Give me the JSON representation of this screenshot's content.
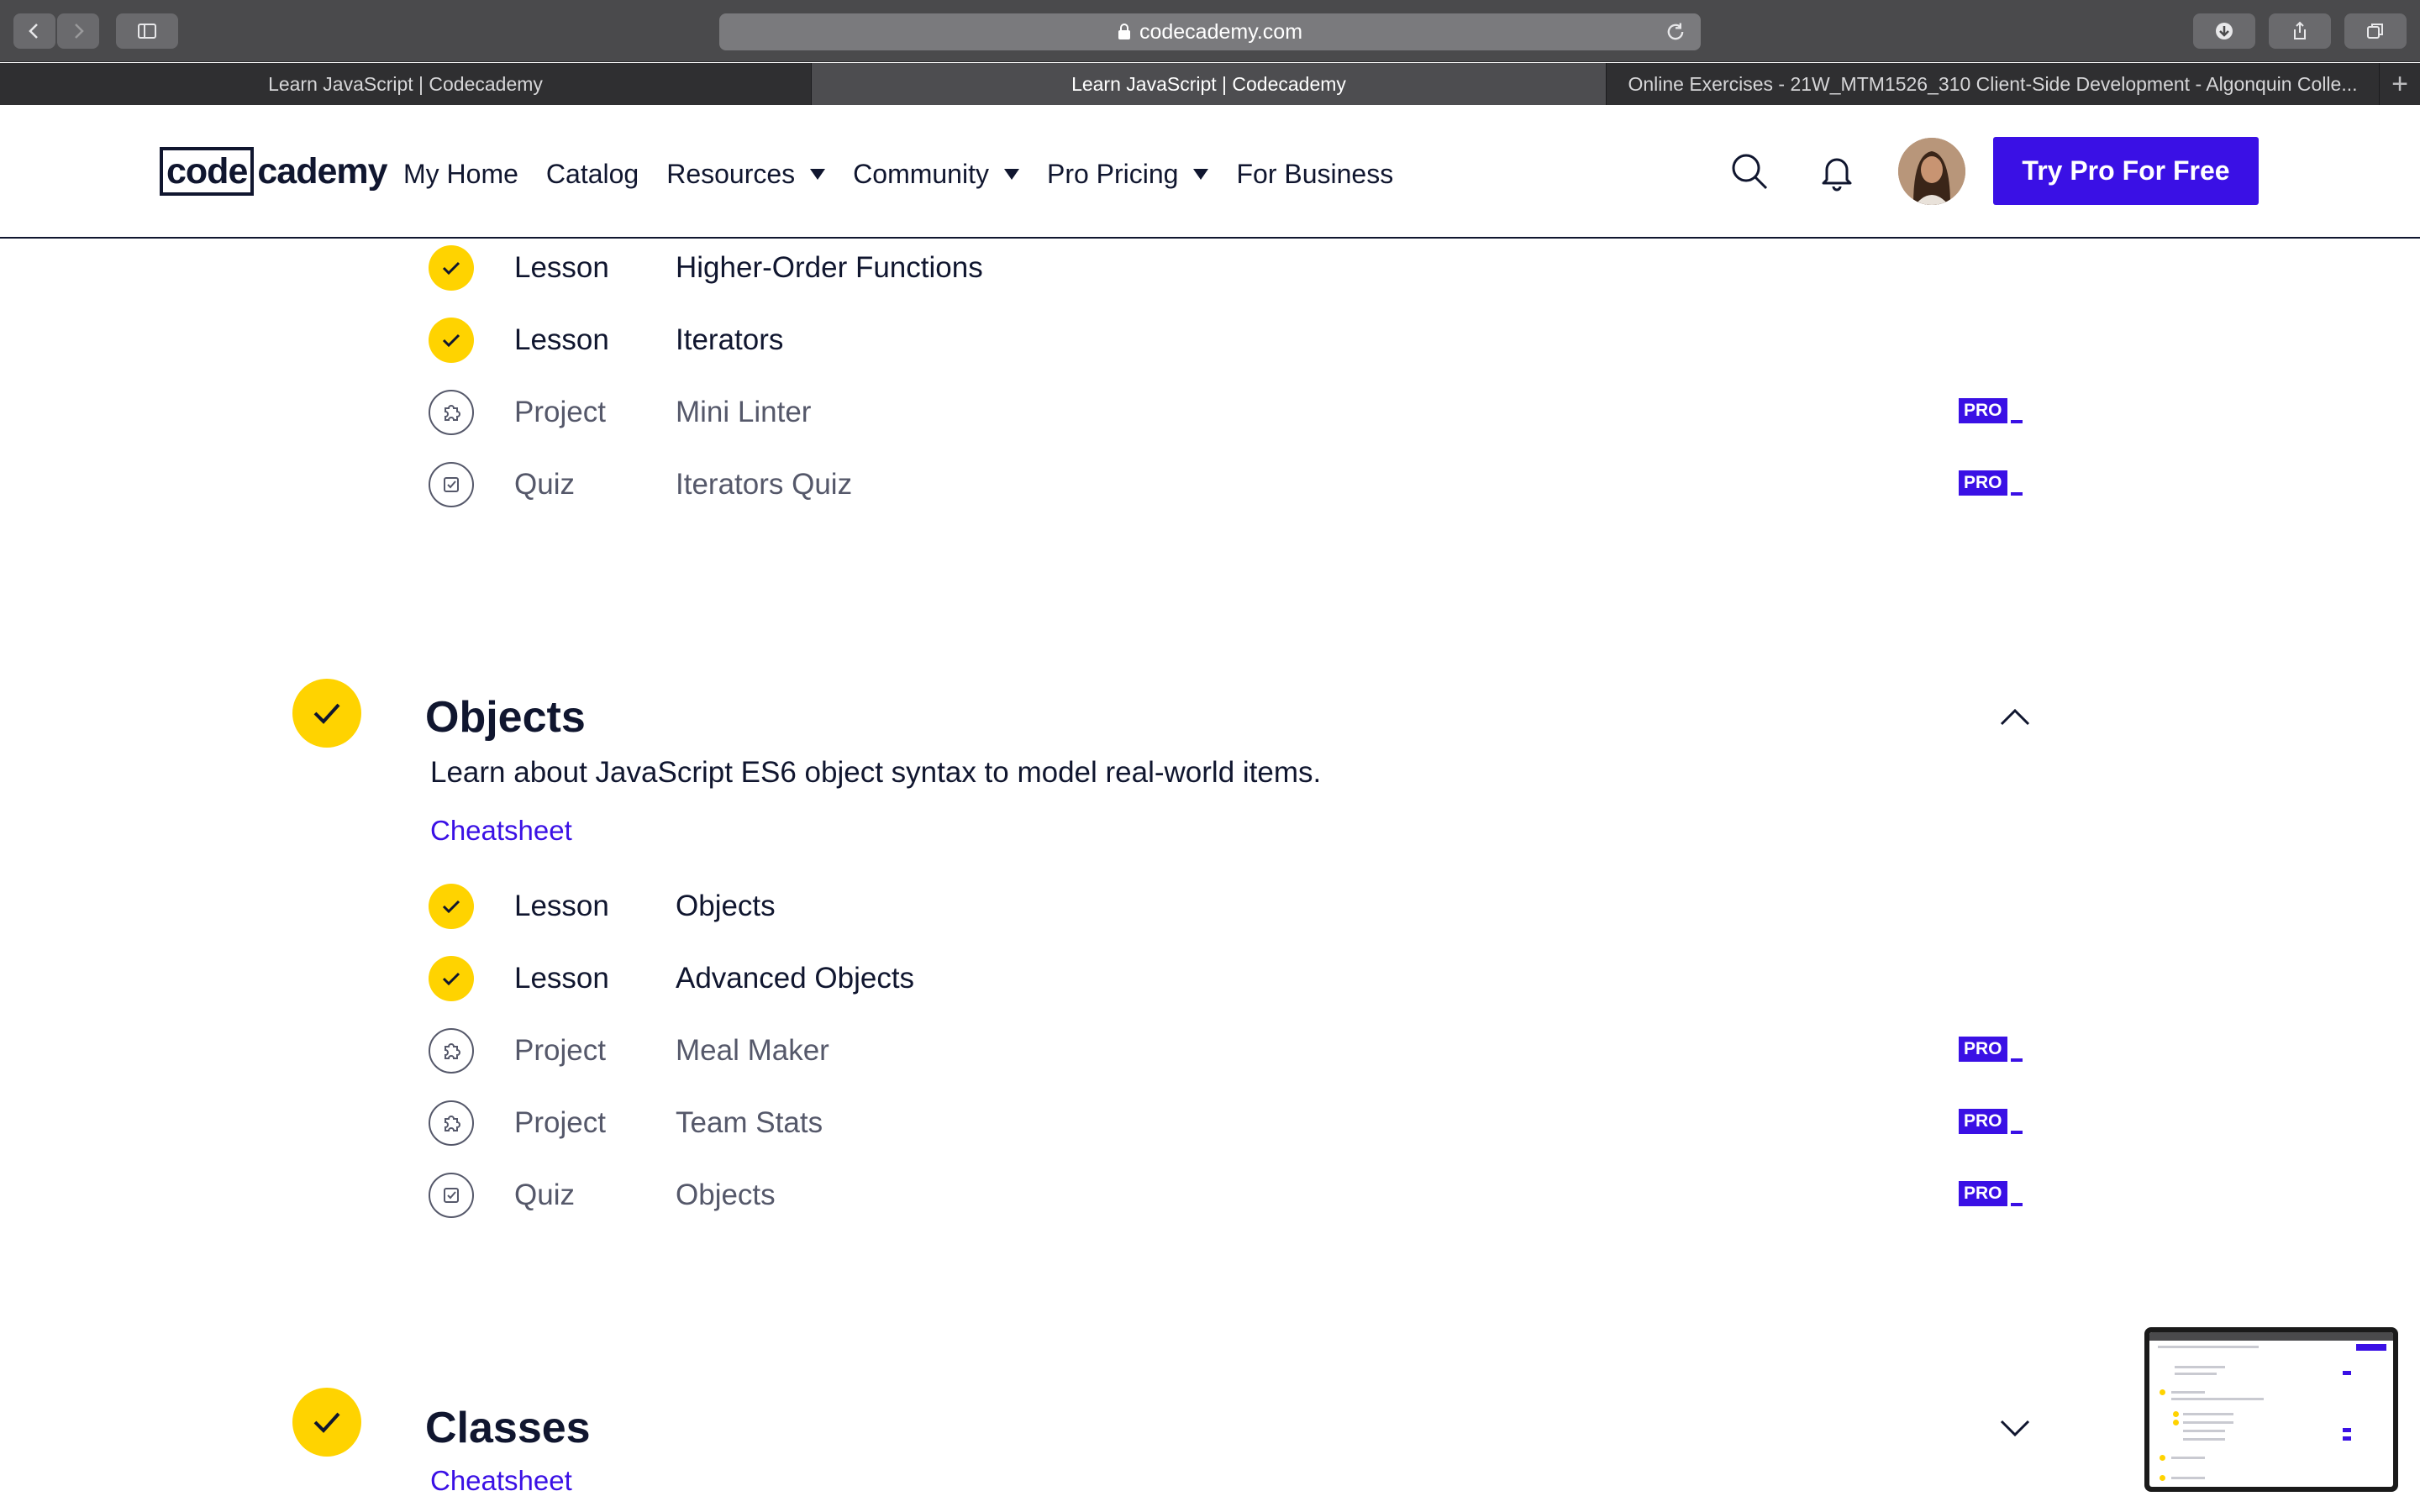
{
  "browser": {
    "url": "codecademy.com",
    "tabs": [
      {
        "label": "Learn JavaScript | Codecademy",
        "active": false
      },
      {
        "label": "Learn JavaScript | Codecademy",
        "active": true
      },
      {
        "label": "Online Exercises - 21W_MTM1526_310 Client-Side Development - Algonquin Colle...",
        "active": false
      }
    ]
  },
  "header": {
    "logo_box": "code",
    "logo_rest": "cademy",
    "nav": {
      "my_home": "My Home",
      "catalog": "Catalog",
      "resources": "Resources",
      "community": "Community",
      "pro_pricing": "Pro Pricing",
      "for_business": "For Business"
    },
    "cta": "Try Pro For Free"
  },
  "pro_badge": "PRO",
  "iterators_section": {
    "items": [
      {
        "type": "Lesson",
        "name": "Higher-Order Functions",
        "completed": true,
        "icon": "check-icon",
        "pro": false
      },
      {
        "type": "Lesson",
        "name": "Iterators",
        "completed": true,
        "icon": "check-icon",
        "pro": false
      },
      {
        "type": "Project",
        "name": "Mini Linter",
        "completed": false,
        "icon": "puzzle-icon",
        "pro": true
      },
      {
        "type": "Quiz",
        "name": "Iterators Quiz",
        "completed": false,
        "icon": "quiz-icon",
        "pro": true
      }
    ]
  },
  "objects_module": {
    "title": "Objects",
    "description": "Learn about JavaScript ES6 object syntax to model real-world items.",
    "cheatsheet": "Cheatsheet",
    "expanded": true,
    "items": [
      {
        "type": "Lesson",
        "name": "Objects",
        "completed": true,
        "icon": "check-icon",
        "pro": false
      },
      {
        "type": "Lesson",
        "name": "Advanced Objects",
        "completed": true,
        "icon": "check-icon",
        "pro": false
      },
      {
        "type": "Project",
        "name": "Meal Maker",
        "completed": false,
        "icon": "puzzle-icon",
        "pro": true
      },
      {
        "type": "Project",
        "name": "Team Stats",
        "completed": false,
        "icon": "puzzle-icon",
        "pro": true
      },
      {
        "type": "Quiz",
        "name": "Objects",
        "completed": false,
        "icon": "quiz-icon",
        "pro": true
      }
    ]
  },
  "classes_module": {
    "title": "Classes",
    "cheatsheet": "Cheatsheet",
    "expanded": false
  },
  "colors": {
    "brand": "#3a10e5",
    "complete": "#ffd300",
    "navy": "#10162f"
  }
}
